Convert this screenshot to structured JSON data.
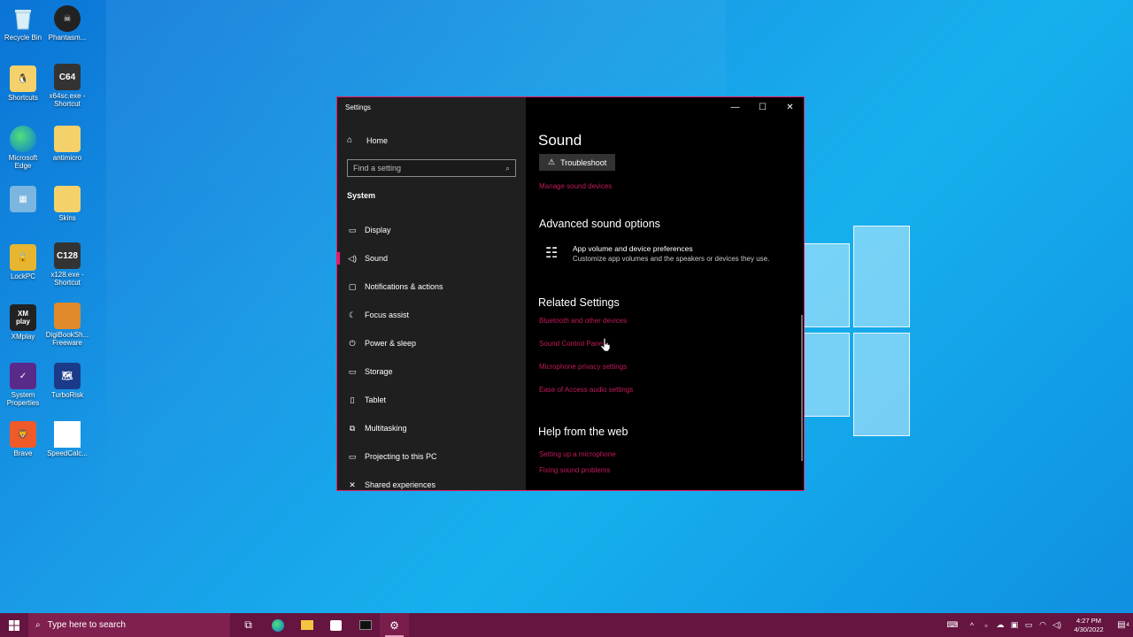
{
  "desktop": {
    "icons": [
      {
        "label": "Recycle Bin",
        "icon": "recycle-bin-icon"
      },
      {
        "label": "Phantasm...",
        "icon": "app-icon"
      },
      {
        "label": "Shortcuts",
        "icon": "folder-icon"
      },
      {
        "label": "x64sc.exe - Shortcut",
        "icon": "c64-icon",
        "text": "C64"
      },
      {
        "label": "Microsoft Edge",
        "icon": "edge-icon"
      },
      {
        "label": "antimicro",
        "icon": "folder-icon"
      },
      {
        "label": "",
        "icon": "control-panel-icon"
      },
      {
        "label": "Skins",
        "icon": "folder-icon"
      },
      {
        "label": "LockPC",
        "icon": "lock-icon"
      },
      {
        "label": "x128.exe - Shortcut",
        "icon": "c128-icon",
        "text": "C128"
      },
      {
        "label": "XMplay",
        "icon": "xmplay-icon",
        "text": "XM play"
      },
      {
        "label": "DigiBookSh... Freeware",
        "icon": "book-icon"
      },
      {
        "label": "System Properties",
        "icon": "system-properties-icon"
      },
      {
        "label": "TurboRisk",
        "icon": "map-icon"
      },
      {
        "label": "Brave",
        "icon": "brave-icon"
      },
      {
        "label": "SpeedCalc...",
        "icon": "document-icon"
      }
    ]
  },
  "window": {
    "title": "Settings",
    "controls": {
      "minimize": "—",
      "maximize": "☐",
      "close": "✕"
    },
    "accent": "#e81a6a"
  },
  "sidebar": {
    "home": "Home",
    "search_placeholder": "Find a setting",
    "section": "System",
    "items": [
      {
        "label": "Display",
        "icon": "monitor-icon",
        "glyph": "▭"
      },
      {
        "label": "Sound",
        "icon": "speaker-icon",
        "glyph": "🔊",
        "active": true
      },
      {
        "label": "Notifications & actions",
        "icon": "notification-icon",
        "glyph": "▢"
      },
      {
        "label": "Focus assist",
        "icon": "moon-icon",
        "glyph": "☾"
      },
      {
        "label": "Power & sleep",
        "icon": "power-icon",
        "glyph": "⏻"
      },
      {
        "label": "Storage",
        "icon": "storage-icon",
        "glyph": "▭"
      },
      {
        "label": "Tablet",
        "icon": "tablet-icon",
        "glyph": "▯"
      },
      {
        "label": "Multitasking",
        "icon": "multitasking-icon",
        "glyph": "⧉"
      },
      {
        "label": "Projecting to this PC",
        "icon": "projecting-icon",
        "glyph": "▭"
      },
      {
        "label": "Shared experiences",
        "icon": "shared-icon",
        "glyph": "✕"
      }
    ]
  },
  "main": {
    "title": "Sound",
    "troubleshoot": "Troubleshoot",
    "manage_devices": "Manage sound devices",
    "advanced_heading": "Advanced sound options",
    "app_volume_title": "App volume and device preferences",
    "app_volume_desc": "Customize app volumes and the speakers or devices they use.",
    "related_heading": "Related Settings",
    "related_links": [
      "Bluetooth and other devices",
      "Sound Control Panel",
      "Microphone privacy settings",
      "Ease of Access audio settings"
    ],
    "help_heading": "Help from the web",
    "help_links": [
      "Setting up a microphone",
      "Fixing sound problems"
    ],
    "link_color": "#c21a5c"
  },
  "taskbar": {
    "search_placeholder": "Type here to search",
    "apps": [
      "task-view-icon",
      "edge-icon",
      "file-explorer-icon",
      "store-icon",
      "terminal-icon",
      "settings-icon"
    ],
    "time": "4:27 PM",
    "date": "4/30/2022",
    "notification_count": "4"
  }
}
